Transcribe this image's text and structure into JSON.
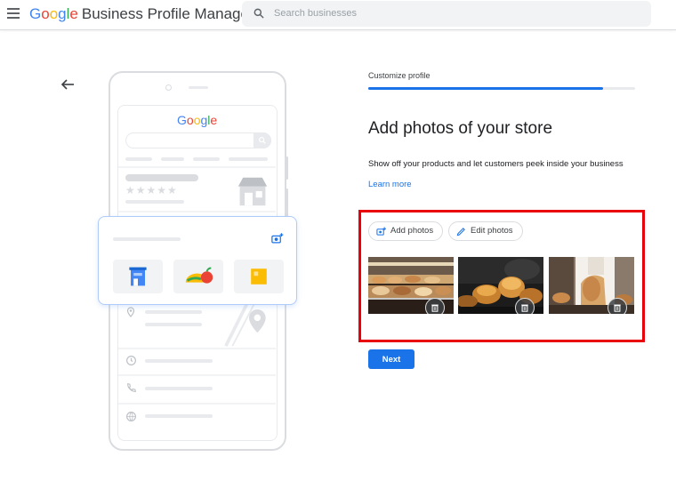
{
  "header": {
    "logo_letters": [
      "G",
      "o",
      "o",
      "g",
      "l",
      "e"
    ],
    "logo_colors": [
      "#4285f4",
      "#ea4335",
      "#fbbc05",
      "#4285f4",
      "#34a853",
      "#ea4335"
    ],
    "product_name": "Business Profile Manager",
    "search_placeholder": "Search businesses",
    "search_value": ""
  },
  "illustration": {
    "brand_text": "Google",
    "rating_stars": "★★★★★",
    "icons": [
      "store-icon",
      "add-photo-icon",
      "storefront-tile-icon",
      "food-tile-icon",
      "note-tile-icon",
      "location-pin-icon",
      "clock-icon",
      "phone-icon",
      "globe-icon"
    ]
  },
  "main": {
    "step_label": "Customize profile",
    "progress": 0.88,
    "title": "Add photos of your store",
    "description": "Show off your products and let customers peek inside your business",
    "learn_more": "Learn more",
    "actions": {
      "add_photos": "Add photos",
      "edit_photos": "Edit photos"
    },
    "photos": [
      {
        "subject": "bakery display case"
      },
      {
        "subject": "glazed buns"
      },
      {
        "subject": "baker holding bread"
      }
    ],
    "next_label": "Next"
  },
  "colors": {
    "accent": "#1a73e8",
    "highlight": "#e8000b"
  }
}
